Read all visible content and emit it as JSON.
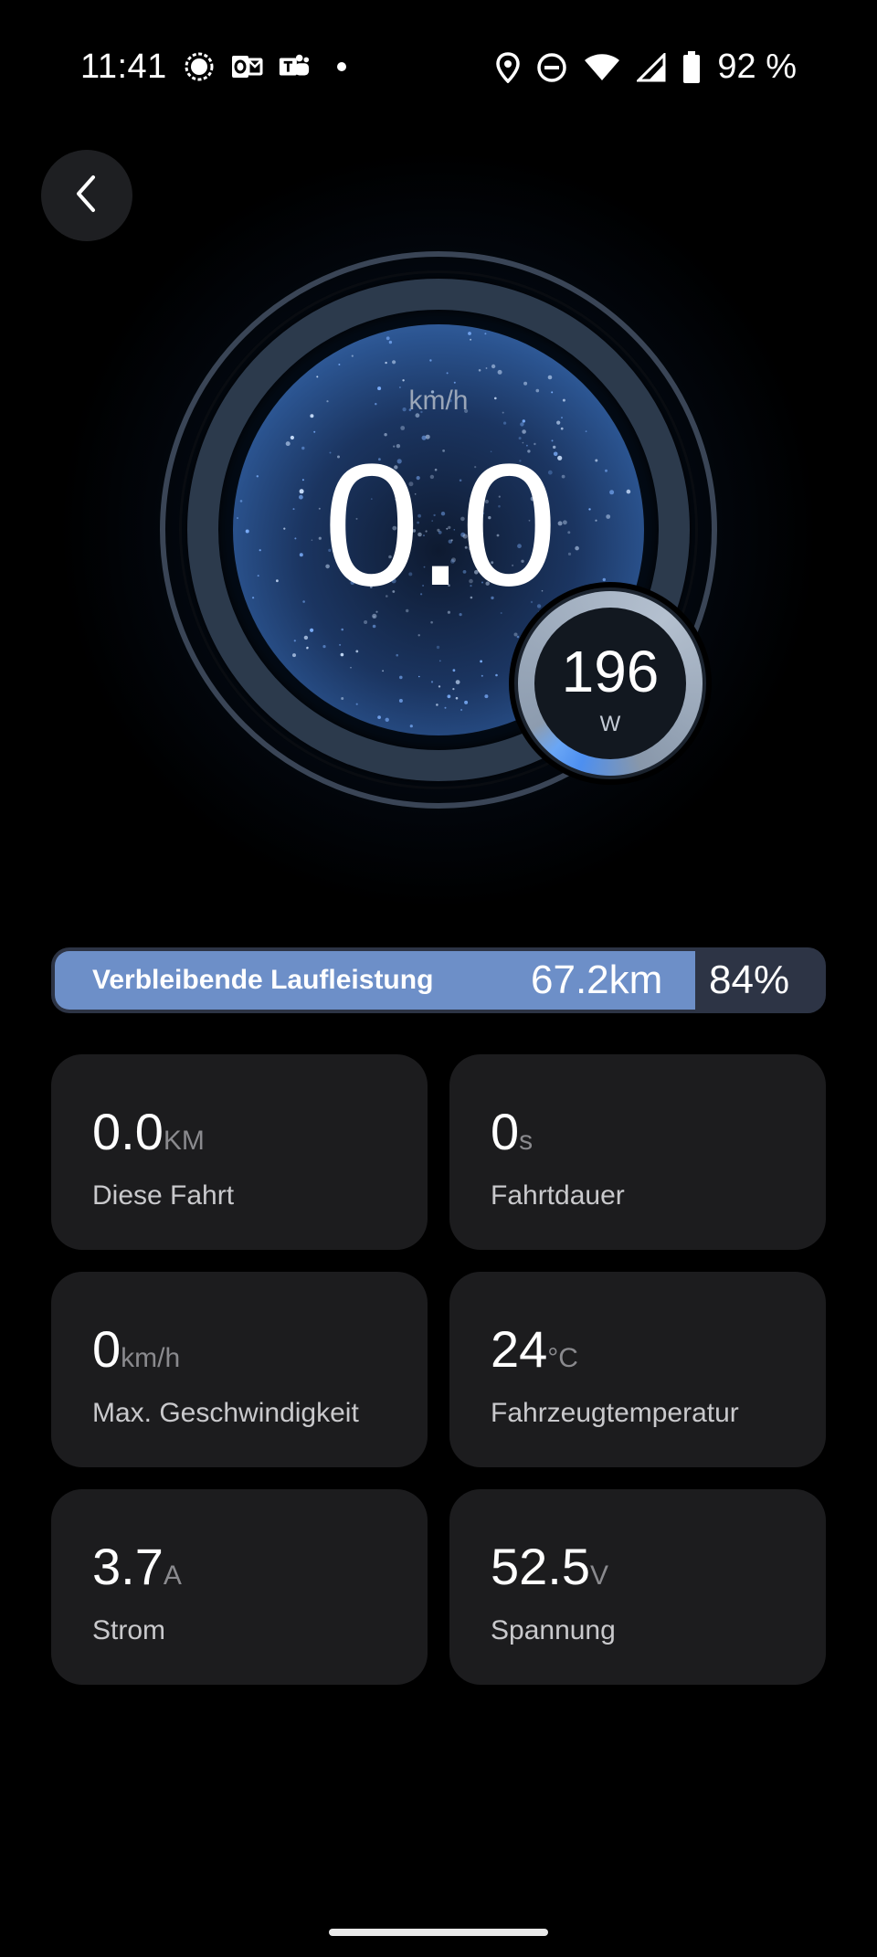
{
  "status_bar": {
    "time": "11:41",
    "battery": "92 %",
    "icons": [
      "signal-messenger-icon",
      "outlook-icon",
      "teams-icon",
      "notification-dot-icon",
      "location-icon",
      "do-not-disturb-icon",
      "wifi-icon",
      "cell-signal-icon",
      "battery-icon"
    ]
  },
  "speedometer": {
    "unit": "km/h",
    "value": "0.0",
    "power_value": "196",
    "power_unit": "W"
  },
  "range": {
    "label": "Verbleibende Laufleistung",
    "distance": "67.2km",
    "percent": "84%",
    "fill_fraction": 0.84
  },
  "stats": [
    {
      "value": "0.0",
      "unit": "KM",
      "label": "Diese Fahrt"
    },
    {
      "value": "0",
      "unit": "s",
      "label": "Fahrtdauer"
    },
    {
      "value": "0",
      "unit": "km/h",
      "label": "Max. Geschwindigkeit"
    },
    {
      "value": "24",
      "unit": "°C",
      "label": "Fahrzeugtemperatur"
    },
    {
      "value": "3.7",
      "unit": "A",
      "label": "Strom"
    },
    {
      "value": "52.5",
      "unit": "V",
      "label": "Spannung"
    }
  ],
  "colors": {
    "background": "#000000",
    "card": "#1c1c1e",
    "range_fill": "#6d8fc8",
    "accent_blue": "#4d8ff0"
  }
}
